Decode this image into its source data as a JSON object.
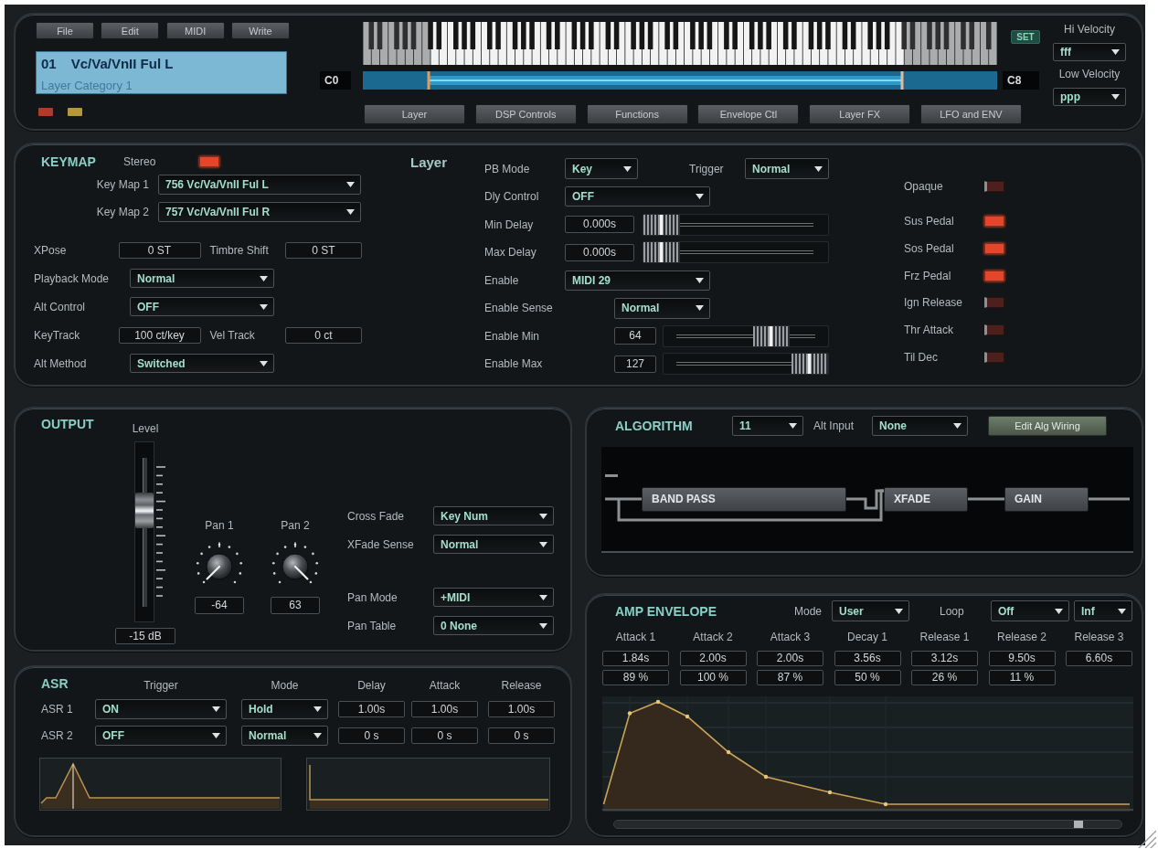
{
  "header": {
    "menu": [
      "File",
      "Edit",
      "MIDI",
      "Write"
    ],
    "patch": {
      "number": "01",
      "name": "Vc/Va/VnII Ful L",
      "category": "Layer Category 1"
    },
    "indicators": [
      {
        "color": "#b33a2b"
      },
      {
        "color": "#b5973a"
      }
    ],
    "keyboard": {
      "low_key": "C0",
      "high_key": "C8",
      "set": "SET"
    },
    "pages": [
      "Layer",
      "DSP Controls",
      "Functions",
      "Envelope Ctl",
      "Layer FX",
      "LFO and ENV"
    ],
    "velocity": [
      {
        "label": "Hi Velocity",
        "value": "fff"
      },
      {
        "label": "Low Velocity",
        "value": "ppp"
      }
    ]
  },
  "keymap": {
    "title": "KEYMAP",
    "stereo": {
      "label": "Stereo",
      "on": true
    },
    "key_maps": [
      {
        "label": "Key Map 1",
        "value": "756 Vc/Va/VnII Ful L"
      },
      {
        "label": "Key Map 2",
        "value": "757 Vc/Va/VnII Ful R"
      }
    ],
    "rows": [
      [
        {
          "kind": "field",
          "label": "XPose",
          "value": "0 ST"
        },
        {
          "kind": "field",
          "label": "Timbre Shift",
          "value": "0 ST"
        }
      ],
      [
        {
          "kind": "dropdown",
          "label": "Playback Mode",
          "value": "Normal"
        }
      ],
      [
        {
          "kind": "dropdown",
          "label": "Alt Control",
          "value": "OFF"
        }
      ],
      [
        {
          "kind": "field",
          "label": "KeyTrack",
          "value": "100 ct/key"
        },
        {
          "kind": "field",
          "label": "Vel Track",
          "value": "0 ct"
        }
      ],
      [
        {
          "kind": "dropdown",
          "label": "Alt Method",
          "value": "Switched"
        }
      ]
    ]
  },
  "layer": {
    "title": "Layer",
    "rows": [
      [
        {
          "kind": "dropdown",
          "label": "PB Mode",
          "value": "Key"
        },
        {
          "kind": "dropdown",
          "label": "Trigger",
          "value": "Normal"
        }
      ],
      [
        {
          "kind": "dropdown",
          "label": "Dly Control",
          "value": "OFF"
        }
      ],
      [
        {
          "kind": "slider",
          "label": "Min Delay",
          "value": "0.000s",
          "level": 0
        }
      ],
      [
        {
          "kind": "slider",
          "label": "Max Delay",
          "value": "0.000s",
          "level": 0
        }
      ],
      [
        {
          "kind": "dropdown",
          "label": "Enable",
          "value": "MIDI 29"
        }
      ],
      [
        {
          "kind": "dropdown",
          "label": "Enable Sense",
          "value": "Normal"
        }
      ],
      [
        {
          "kind": "slider",
          "label": "Enable Min",
          "value": "64",
          "level": 0.7
        }
      ],
      [
        {
          "kind": "slider",
          "label": "Enable Max",
          "value": "127",
          "level": 1
        }
      ]
    ],
    "switches": [
      {
        "label": "Opaque",
        "on": false
      },
      {
        "label": "Sus Pedal",
        "on": true
      },
      {
        "label": "Sos Pedal",
        "on": true
      },
      {
        "label": "Frz Pedal",
        "on": true
      },
      {
        "label": "Ign Release",
        "on": false
      },
      {
        "label": "Thr Attack",
        "on": false
      },
      {
        "label": "Til Dec",
        "on": false
      }
    ]
  },
  "output": {
    "title": "OUTPUT",
    "fader": {
      "label": "Level",
      "level": 0.65,
      "value": "-15 dB"
    },
    "pans": [
      {
        "label": "Pan 1",
        "value": "-64"
      },
      {
        "label": "Pan 2",
        "value": "63"
      }
    ],
    "groups": [
      [
        {
          "label": "Cross Fade",
          "value": "Key Num"
        },
        {
          "label": "XFade Sense",
          "value": "Normal"
        }
      ],
      [
        {
          "label": "Pan Mode",
          "value": "+MIDI"
        },
        {
          "label": "Pan Table",
          "value": "0 None"
        }
      ]
    ]
  },
  "asr": {
    "title": "ASR",
    "columns": [
      "Trigger",
      "Mode",
      "Delay",
      "Attack",
      "Release"
    ],
    "rows": [
      {
        "label": "ASR 1",
        "trigger": "ON",
        "mode": "Hold",
        "delay": "1.00s",
        "attack": "1.00s",
        "release": "1.00s"
      },
      {
        "label": "ASR 2",
        "trigger": "OFF",
        "mode": "Normal",
        "delay": "0 s",
        "attack": "0 s",
        "release": "0 s"
      }
    ]
  },
  "algorithm": {
    "title": "ALGORITHM",
    "value": "11",
    "alt_input": {
      "label": "Alt Input",
      "value": "None"
    },
    "edit_button": "Edit Alg Wiring",
    "blocks": [
      "BAND PASS",
      "XFADE",
      "GAIN"
    ]
  },
  "amp_envelope": {
    "title": "AMP ENVELOPE",
    "mode": {
      "label": "Mode",
      "value": "User"
    },
    "loop": {
      "label": "Loop",
      "value": "Off",
      "repeat": "Inf"
    },
    "segments": [
      {
        "label": "Attack 1",
        "time": "1.84s",
        "amount": "89 %"
      },
      {
        "label": "Attack 2",
        "time": "2.00s",
        "amount": "100 %"
      },
      {
        "label": "Attack 3",
        "time": "2.00s",
        "amount": "87 %"
      },
      {
        "label": "Decay 1",
        "time": "3.56s",
        "amount": "50 %"
      },
      {
        "label": "Release 1",
        "time": "3.12s",
        "amount": "26 %"
      },
      {
        "label": "Release 2",
        "time": "9.50s",
        "amount": "11 %"
      },
      {
        "label": "Release 3",
        "time": "6.60s"
      }
    ]
  }
}
